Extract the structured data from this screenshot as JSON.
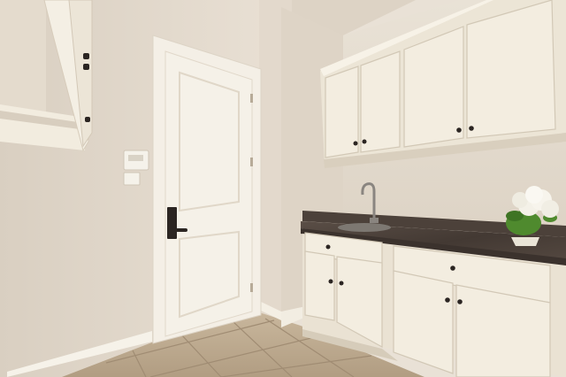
{
  "scene": {
    "subject": "laundry-room",
    "objects": [
      "door",
      "open-shelf-cabinet",
      "wall-thermostat",
      "light-switch",
      "upper-cabinets",
      "lower-cabinets",
      "granite-countertop",
      "sink",
      "faucet",
      "hydrangea-plant",
      "tile-floor",
      "baseboard"
    ],
    "colors": {
      "wall": "#e6ddd1",
      "wall_shadow": "#d8cdbf",
      "ceiling": "#ddd3c5",
      "cabinet": "#f3ede0",
      "cabinet_shade": "#e2d9c8",
      "door": "#f4f0e6",
      "trim": "#f7f3ea",
      "countertop": "#4b3f38",
      "floor": "#b9a68d",
      "floor_grout": "#a08c73",
      "hardware": "#2b2522",
      "flowers": "#f4f1e8",
      "leaves": "#4f8a2e"
    }
  }
}
